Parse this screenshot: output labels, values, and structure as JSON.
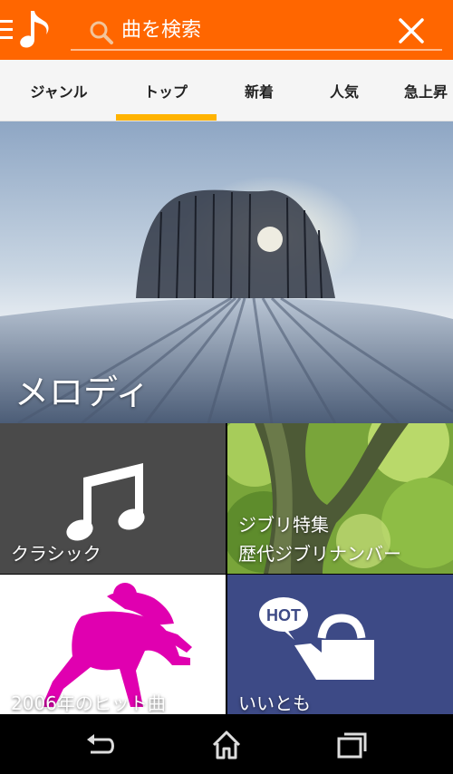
{
  "header": {
    "search_placeholder": "曲を検索",
    "accent_color": "#ff6600",
    "icons": [
      "menu-icon",
      "music-note-logo-icon",
      "search-icon",
      "close-icon"
    ]
  },
  "tabs": {
    "selected": "トップ",
    "indicator_color": "#ffb300",
    "items": [
      {
        "label": "ジャンル"
      },
      {
        "label": "トップ"
      },
      {
        "label": "新着"
      },
      {
        "label": "人気"
      },
      {
        "label": "急上昇"
      }
    ]
  },
  "hero": {
    "label": "メロディ"
  },
  "tiles": {
    "classic": {
      "label": "クラシック"
    },
    "ghibli": {
      "line1": "ジブリ特集",
      "line2": "歴代ジブリナンバー"
    },
    "hits2006": {
      "label": "2006年のヒット曲"
    },
    "iitomo": {
      "label": "いいとも",
      "badge": "HOT"
    }
  },
  "navbar": {
    "icons": [
      "back-icon",
      "home-icon",
      "recent-apps-icon"
    ]
  }
}
